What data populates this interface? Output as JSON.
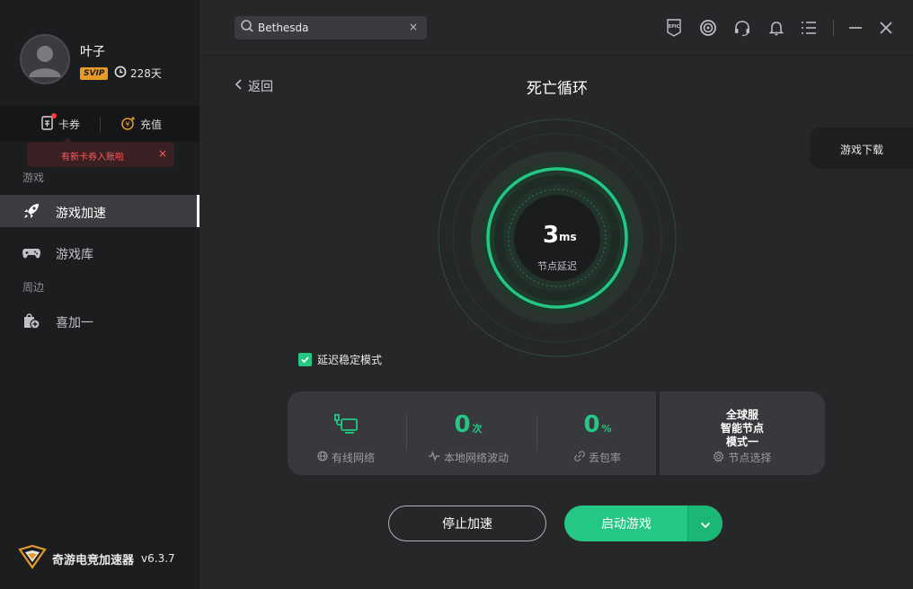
{
  "user": {
    "name": "叶子",
    "vip_badge": "SVIP",
    "days": "228天"
  },
  "wallet": {
    "coupon_label": "卡券",
    "recharge_label": "充值"
  },
  "tooltip": {
    "text": "有新卡券入账啦",
    "close": "×"
  },
  "sidebar": {
    "section_game": "游戏",
    "items": [
      {
        "label": "游戏加速"
      },
      {
        "label": "游戏库"
      }
    ],
    "section_around": "周边",
    "extra_item": "喜加一"
  },
  "brand": {
    "name": "奇游电竞加速器",
    "version": "v6.3.7"
  },
  "search": {
    "value": "Bethesda",
    "clear": "×"
  },
  "top_icons": [
    "epic-games-icon",
    "ubisoft-icon",
    "headset-support-icon",
    "bell-icon",
    "menu-icon",
    "minimize-icon",
    "close-icon"
  ],
  "main": {
    "back_label": "返回",
    "game_title": "死亡循环",
    "download_label": "游戏下载",
    "latency": {
      "value": "3",
      "unit": "ms",
      "label": "节点延迟"
    },
    "stable_mode_label": "延迟稳定模式",
    "stats": [
      {
        "icon": "wired-network-icon",
        "caption": "有线网络"
      },
      {
        "value": "0",
        "unit": "次",
        "caption": "本地网络波动"
      },
      {
        "value": "0",
        "unit": "%",
        "caption": "丢包率"
      }
    ],
    "node": {
      "line1": "全球服",
      "line2": "智能节点",
      "line3": "模式一",
      "caption": "节点选择"
    },
    "stop_label": "停止加速",
    "launch_label": "启动游戏"
  },
  "colors": {
    "accent": "#22c883",
    "sidebar": "#1c1d1f",
    "background": "#262729",
    "panel": "#38393c",
    "warn": "#ff5c5c",
    "vip": "#e79a2a"
  }
}
